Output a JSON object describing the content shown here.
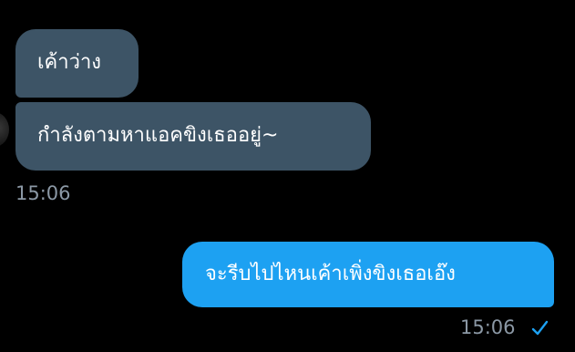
{
  "messages": [
    {
      "direction": "incoming",
      "text": "เค้าว่าง"
    },
    {
      "direction": "incoming",
      "text": "กำลังตามหาแอคขิงเธออยู่~"
    },
    {
      "direction": "outgoing",
      "text": "จะรีบไปไหนเค้าเพิ่งขิงเธอเอ๊ง"
    }
  ],
  "timestamps": {
    "incoming_group": "15:06",
    "outgoing": "15:06"
  },
  "icons": {
    "sent_status": "check-icon"
  },
  "colors": {
    "background": "#000000",
    "incoming_bubble": "#3d5466",
    "outgoing_bubble": "#1da1f2",
    "timestamp_text": "#8b98a5",
    "check_mark": "#1da1f2"
  }
}
